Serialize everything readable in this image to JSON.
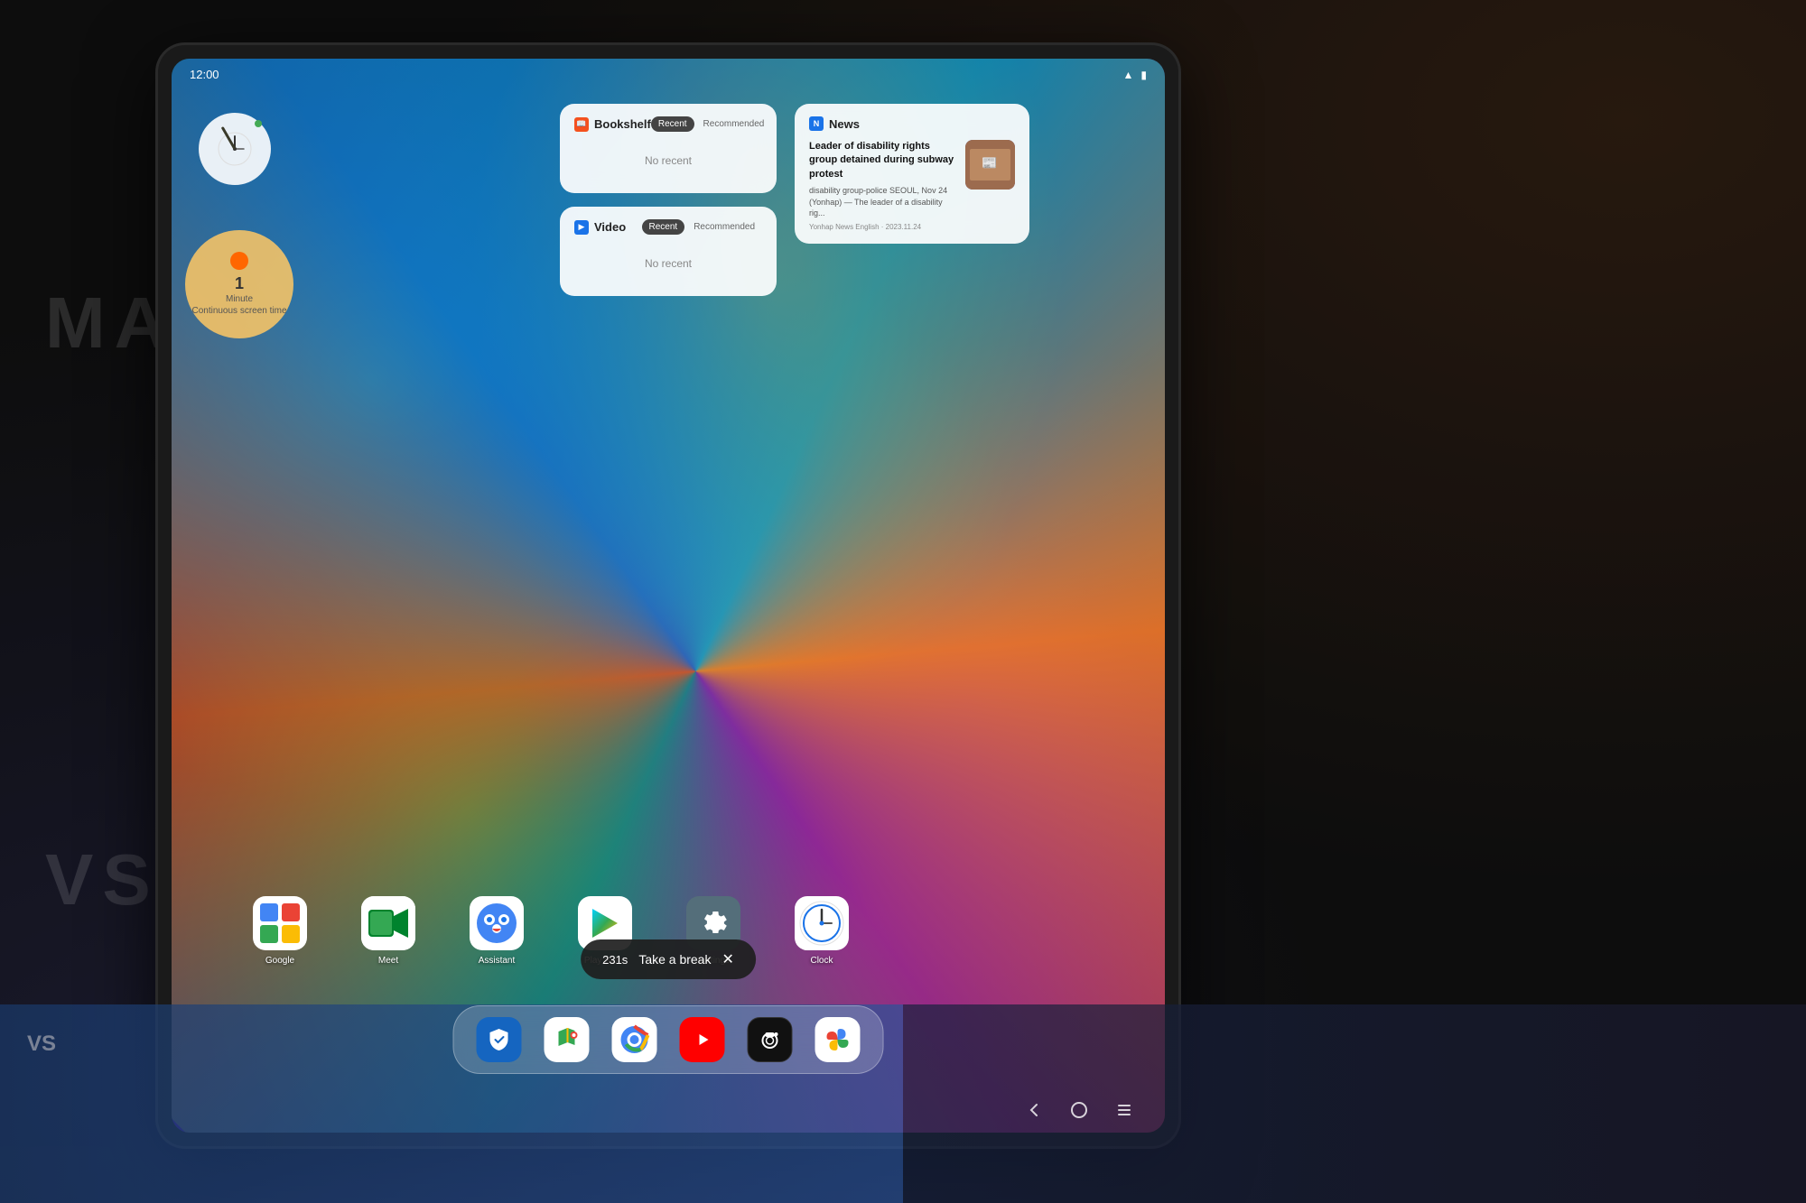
{
  "background": {
    "color": "#111111"
  },
  "tablet": {
    "screen": {
      "wallpaper": "colorful-swirl"
    }
  },
  "topbar": {
    "time": "12:00"
  },
  "widgets": {
    "clock": {
      "label": "Clock"
    },
    "screentime": {
      "minutes": "1",
      "unit": "Minute",
      "label": "Continuous screen time"
    },
    "bookshelf": {
      "title": "Bookshelf",
      "tab_recent": "Recent",
      "tab_recommended": "Recommended",
      "no_recent_text": "No recent",
      "active_tab": "Recent"
    },
    "video": {
      "title": "Video",
      "tab_recent": "Recent",
      "tab_recommended": "Recommended",
      "no_recent_text": "No recent",
      "active_tab": "Recent"
    },
    "news": {
      "title": "News",
      "headline": "Leader of disability rights group detained during subway protest",
      "description": "disability group-police SEOUL, Nov 24 (Yonhap) — The leader of a disability rig...",
      "source": "Yonhap News English · 2023.11.24"
    }
  },
  "apps": [
    {
      "name": "Google",
      "icon": "google",
      "label": "Google"
    },
    {
      "name": "Meet",
      "icon": "meet",
      "label": "Meet"
    },
    {
      "name": "Assistant",
      "icon": "assistant",
      "label": "Assistant"
    },
    {
      "name": "Play Store",
      "icon": "play",
      "label": "Play Store"
    },
    {
      "name": "Settings",
      "icon": "settings",
      "label": "Settings"
    },
    {
      "name": "Clock",
      "icon": "clock",
      "label": "Clock"
    }
  ],
  "dock": [
    {
      "name": "Samsung Security",
      "icon": "shield",
      "color": "#1565c0"
    },
    {
      "name": "Google Maps",
      "icon": "maps",
      "color": "#fff"
    },
    {
      "name": "Chrome",
      "icon": "chrome",
      "color": "#fff"
    },
    {
      "name": "YouTube",
      "icon": "youtube",
      "color": "#ff0000"
    },
    {
      "name": "Camera",
      "icon": "camera",
      "color": "#111"
    },
    {
      "name": "Google Photos",
      "icon": "photos",
      "color": "#fff"
    }
  ],
  "toast": {
    "timer": "231s",
    "message": "Take a break",
    "close_label": "✕"
  },
  "bottomnav": {
    "back": "‹",
    "home": "○",
    "menu": "≡"
  }
}
